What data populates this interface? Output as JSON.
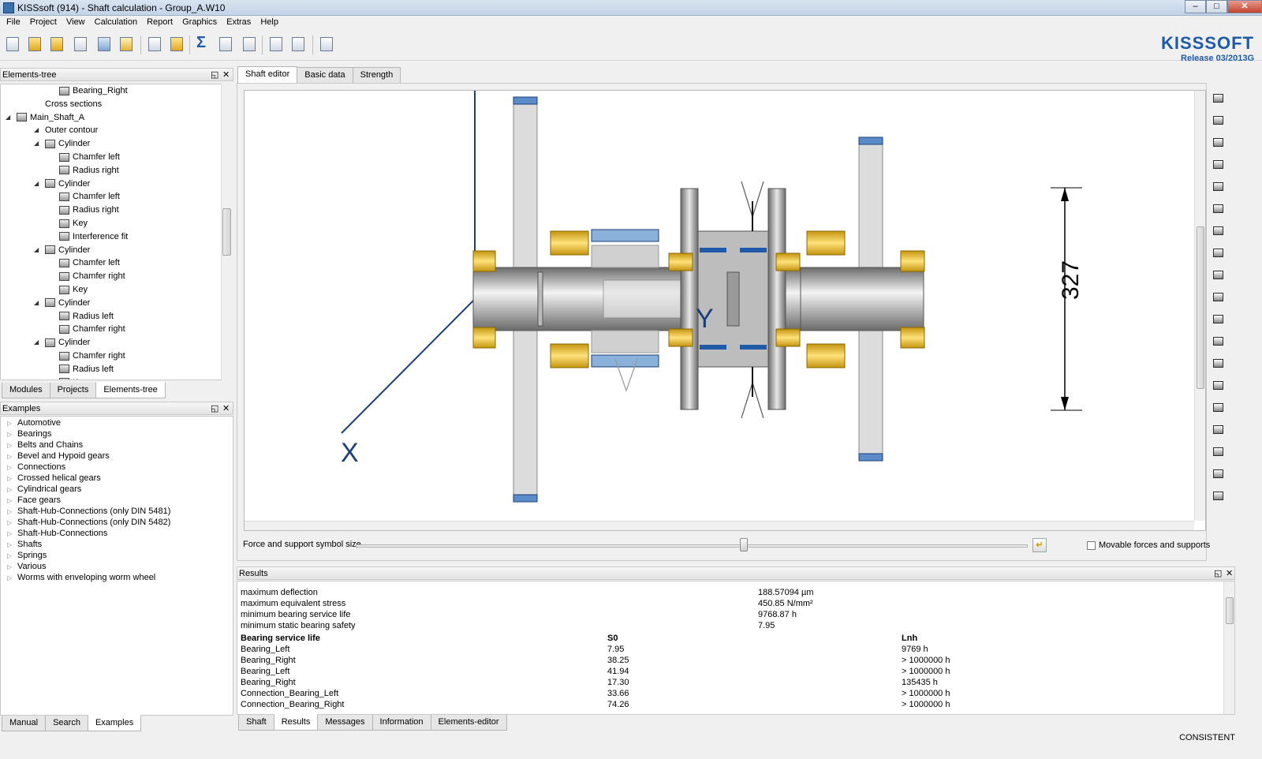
{
  "window": {
    "title": "KISSsoft (914) - Shaft calculation - Group_A.W10",
    "btn_min": "–",
    "btn_max": "□",
    "btn_close": "✕"
  },
  "menu": [
    "File",
    "Project",
    "View",
    "Calculation",
    "Report",
    "Graphics",
    "Extras",
    "Help"
  ],
  "toolbar": {
    "icons": [
      "new-file-icon",
      "open-folder-icon",
      "open-project-icon",
      "save-icon",
      "email-icon",
      "undo-icon",
      "copy-icon",
      "folder-icon",
      "calculate-sum-icon",
      "report-icon",
      "report-view-icon",
      "list-icon",
      "calculator-icon",
      "book-icon"
    ],
    "sum_glyph": "Σ"
  },
  "brand": {
    "logo": "KISSSOFT",
    "release": "Release 03/2013G"
  },
  "elements_tree": {
    "title": "Elements-tree",
    "btn_float": "◱",
    "btn_close": "✕",
    "rows": [
      {
        "label": "Bearing_Right",
        "level": 3,
        "icon": "bearing-icon",
        "expander": ""
      },
      {
        "label": "Cross sections",
        "level": 1,
        "icon": "",
        "expander": ""
      },
      {
        "label": "Main_Shaft_A",
        "level": 0,
        "icon": "shaft-icon",
        "expander": "◢"
      },
      {
        "label": "Outer contour",
        "level": 1,
        "icon": "",
        "expander": "◢"
      },
      {
        "label": "Cylinder",
        "level": 2,
        "icon": "cylinder-icon",
        "expander": "◢"
      },
      {
        "label": "Chamfer left",
        "level": 3,
        "icon": "chamfer-icon",
        "expander": ""
      },
      {
        "label": "Radius right",
        "level": 3,
        "icon": "radius-icon",
        "expander": ""
      },
      {
        "label": "Cylinder",
        "level": 2,
        "icon": "cylinder-icon",
        "expander": "◢"
      },
      {
        "label": "Chamfer left",
        "level": 3,
        "icon": "chamfer-icon",
        "expander": ""
      },
      {
        "label": "Radius right",
        "level": 3,
        "icon": "radius-icon",
        "expander": ""
      },
      {
        "label": "Key",
        "level": 3,
        "icon": "key-icon",
        "expander": ""
      },
      {
        "label": "Interference fit",
        "level": 3,
        "icon": "interference-fit-icon",
        "expander": ""
      },
      {
        "label": "Cylinder",
        "level": 2,
        "icon": "cylinder-icon",
        "expander": "◢"
      },
      {
        "label": "Chamfer left",
        "level": 3,
        "icon": "chamfer-icon",
        "expander": ""
      },
      {
        "label": "Chamfer right",
        "level": 3,
        "icon": "chamfer-icon",
        "expander": ""
      },
      {
        "label": "Key",
        "level": 3,
        "icon": "key-icon",
        "expander": ""
      },
      {
        "label": "Cylinder",
        "level": 2,
        "icon": "cylinder-icon",
        "expander": "◢"
      },
      {
        "label": "Radius left",
        "level": 3,
        "icon": "radius-icon",
        "expander": ""
      },
      {
        "label": "Chamfer right",
        "level": 3,
        "icon": "chamfer-icon",
        "expander": ""
      },
      {
        "label": "Cylinder",
        "level": 2,
        "icon": "cylinder-icon",
        "expander": "◢"
      },
      {
        "label": "Chamfer right",
        "level": 3,
        "icon": "chamfer-icon",
        "expander": ""
      },
      {
        "label": "Radius left",
        "level": 3,
        "icon": "radius-icon",
        "expander": ""
      },
      {
        "label": "Key",
        "level": 3,
        "icon": "key-icon",
        "expander": ""
      }
    ]
  },
  "left_tabs": [
    "Modules",
    "Projects",
    "Elements-tree"
  ],
  "examples": {
    "title": "Examples",
    "btn_float": "◱",
    "btn_close": "✕",
    "items": [
      "Automotive",
      "Bearings",
      "Belts and Chains",
      "Bevel and Hypoid gears",
      "Connections",
      "Crossed helical gears",
      "Cylindrical gears",
      "Face gears",
      "Shaft-Hub-Connections (only DIN 5481)",
      "Shaft-Hub-Connections (only DIN 5482)",
      "Shaft-Hub-Connections",
      "Shafts",
      "Springs",
      "Various",
      "Worms with enveloping worm wheel"
    ],
    "expander": "▷"
  },
  "bottom_left_tabs": [
    "Manual",
    "Search",
    "Examples"
  ],
  "editor_tabs": [
    "Shaft editor",
    "Basic data",
    "Strength"
  ],
  "canvas": {
    "dimension": "327",
    "axis_x": "X",
    "axis_y": "Y"
  },
  "slider": {
    "label": "Force and support symbol size",
    "value_fraction": 0.577
  },
  "movable": {
    "label": "Movable forces and supports",
    "checked": false
  },
  "right_tools": [
    "shaft-icon",
    "cylinder-icon",
    "cone-icon",
    "cylinder-icon",
    "bearing-icon",
    "support-icon",
    "support-icon",
    "bearing-icon",
    "bracket-icon",
    "coupling-icon",
    "force-icon",
    "force-icon",
    "force-icon",
    "mass-icon",
    "key-icon",
    "gear-icon",
    "gear-icon",
    "gear-icon",
    "gear-icon"
  ],
  "results": {
    "title": "Results",
    "btn_float": "◱",
    "btn_close": "✕",
    "summary": [
      {
        "label": "maximum deflection",
        "value": "188.57094 µm"
      },
      {
        "label": "maximum equivalent stress",
        "value": "450.85 N/mm²"
      },
      {
        "label": "minimum bearing service life",
        "value": "9768.87 h"
      },
      {
        "label": "minimum static bearing safety",
        "value": "7.95"
      }
    ],
    "table_header": {
      "name": "Bearing service life",
      "s0": "S0",
      "lnh": "Lnh"
    },
    "rows": [
      {
        "name": "Bearing_Left",
        "s0": "7.95",
        "lnh": "9769 h"
      },
      {
        "name": "Bearing_Right",
        "s0": "38.25",
        "lnh": "> 1000000 h"
      },
      {
        "name": "Bearing_Left",
        "s0": "41.94",
        "lnh": "> 1000000 h"
      },
      {
        "name": "Bearing_Right",
        "s0": "17.30",
        "lnh": "135435 h"
      },
      {
        "name": "Connection_Bearing_Left",
        "s0": "33.66",
        "lnh": "> 1000000 h"
      },
      {
        "name": "Connection_Bearing_Right",
        "s0": "74.26",
        "lnh": "> 1000000 h"
      }
    ]
  },
  "bottom_tabs": [
    "Shaft",
    "Results",
    "Messages",
    "Information",
    "Elements-editor"
  ],
  "status": "CONSISTENT",
  "colors": {
    "bearing": "#f2c531",
    "shaft_dark": "#6e6e6e",
    "accent_blue": "#1e5aa8",
    "sleeve": "#d9d9d9"
  }
}
